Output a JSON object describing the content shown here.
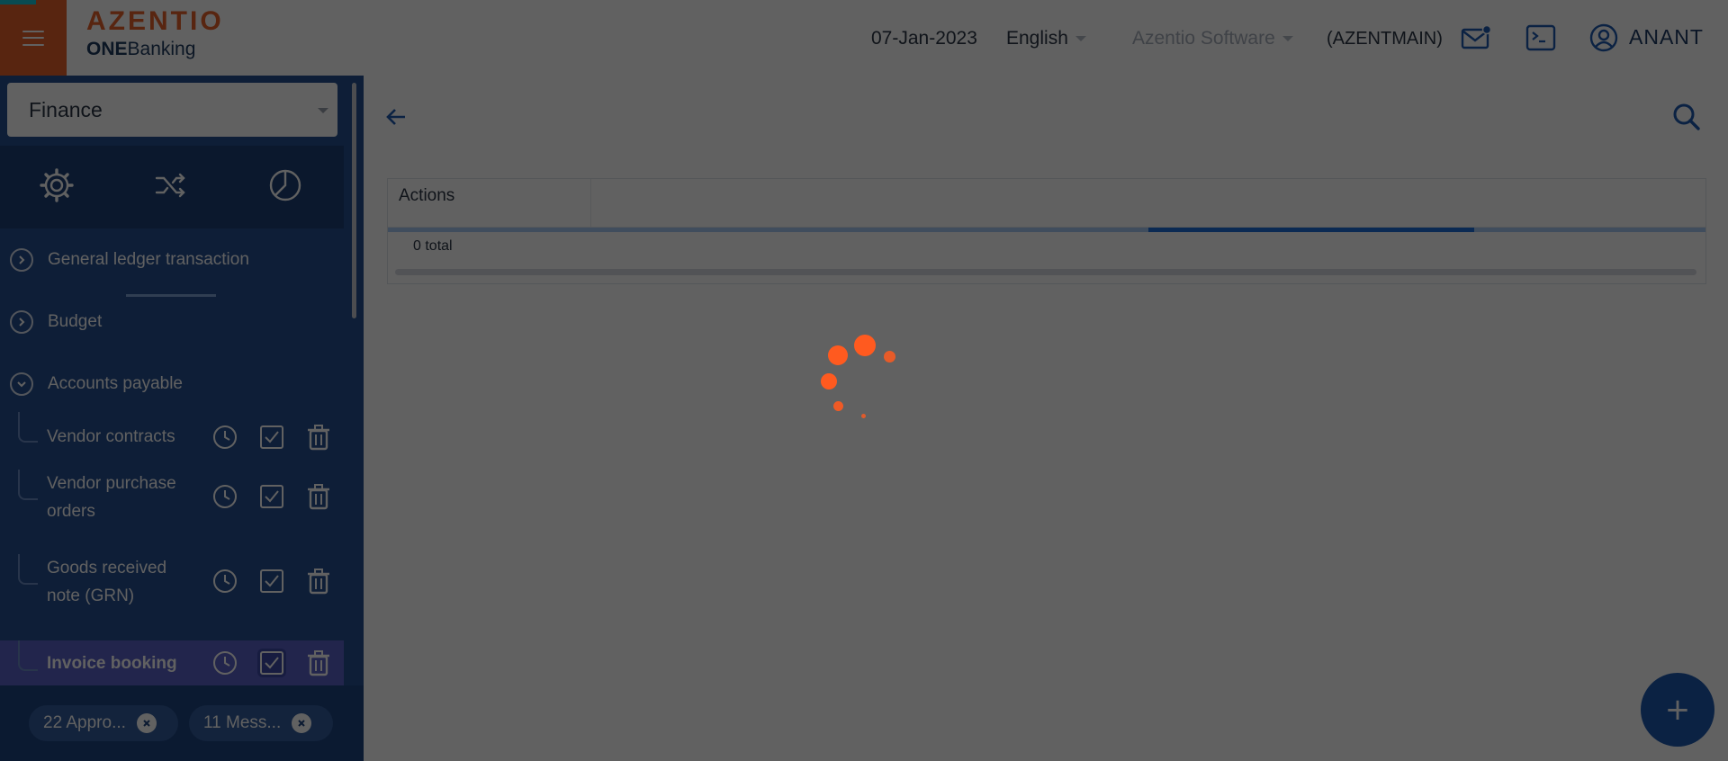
{
  "header": {
    "menu_icon": "hamburger-icon",
    "logo_main": "AZENTIO",
    "logo_sub_bold": "ONE",
    "logo_sub_rest": "Banking",
    "date": "07-Jan-2023",
    "language": "English",
    "company": "Azentio Software",
    "branch": "(AZENTMAIN)",
    "user": "ANANT",
    "icons": [
      "mail-icon",
      "terminal-icon",
      "user-icon"
    ]
  },
  "sidebar": {
    "module": "Finance",
    "tabs": [
      "gear-icon",
      "shuffle-icon",
      "pie-chart-icon"
    ],
    "sections": [
      {
        "label": "General ledger transaction",
        "state": "collapsed"
      },
      {
        "label": "Budget",
        "state": "collapsed"
      },
      {
        "label": "Accounts payable",
        "state": "expanded"
      }
    ],
    "items": [
      {
        "label": "Vendor contracts"
      },
      {
        "label": "Vendor purchase orders"
      },
      {
        "label": "Goods received note (GRN)"
      },
      {
        "label": "Invoice booking"
      }
    ],
    "item_actions": [
      "clock-icon",
      "check-icon",
      "trash-icon"
    ],
    "chips": [
      {
        "label": "22 Appro..."
      },
      {
        "label": "11 Mess..."
      }
    ]
  },
  "main": {
    "grid": {
      "columns": [
        "Actions"
      ],
      "total": "0 total"
    },
    "fab_label": "+"
  },
  "colors": {
    "brand_orange": "#e8622c",
    "sidebar_blue": "#254f91",
    "active_item": "#5a61c8",
    "spinner": "#ff5a1f"
  }
}
